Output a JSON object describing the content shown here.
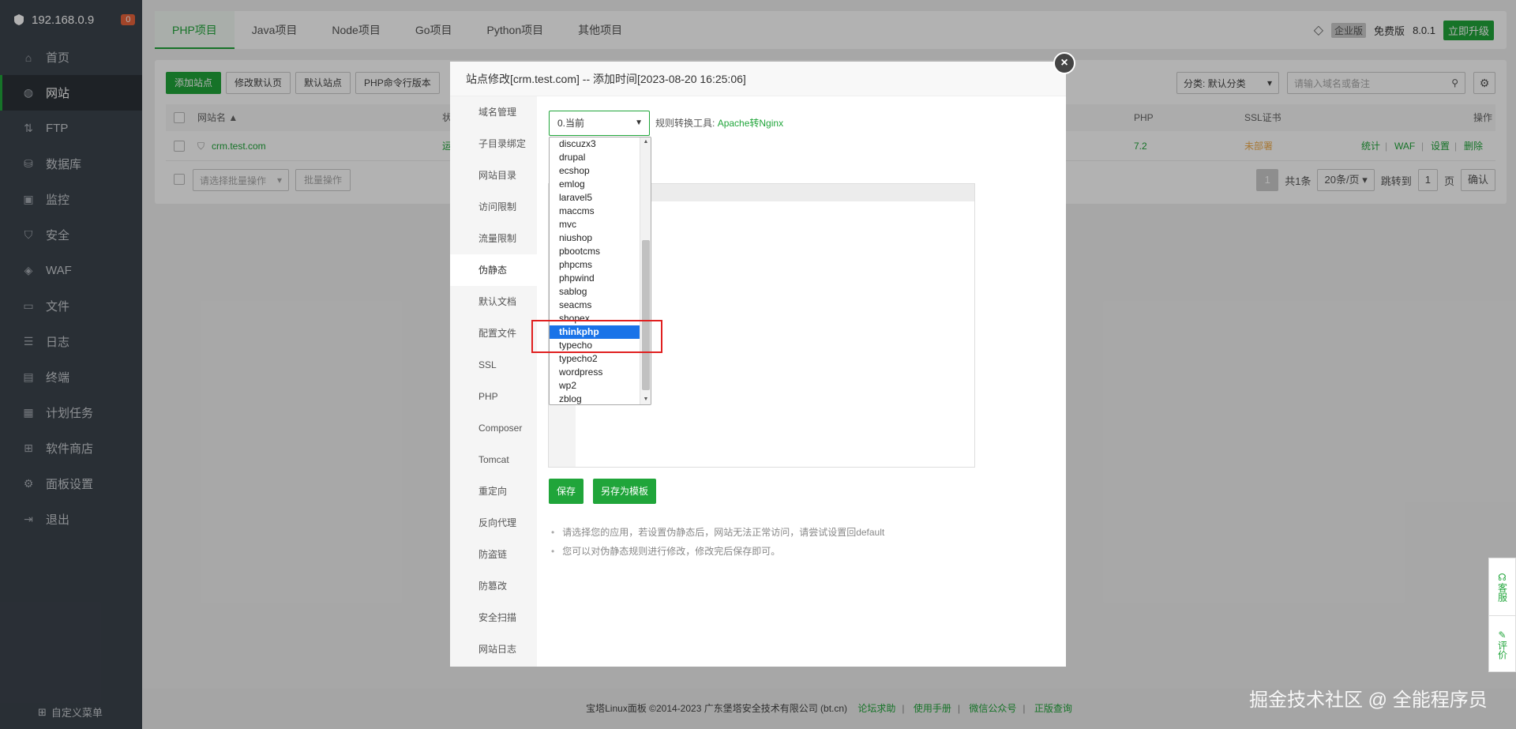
{
  "sidebar": {
    "server": "192.168.0.9",
    "badge": "0",
    "items": [
      {
        "label": "首页"
      },
      {
        "label": "网站"
      },
      {
        "label": "FTP"
      },
      {
        "label": "数据库"
      },
      {
        "label": "监控"
      },
      {
        "label": "安全"
      },
      {
        "label": "WAF"
      },
      {
        "label": "文件"
      },
      {
        "label": "日志"
      },
      {
        "label": "终端"
      },
      {
        "label": "计划任务"
      },
      {
        "label": "软件商店"
      },
      {
        "label": "面板设置"
      },
      {
        "label": "退出"
      }
    ],
    "footer": "自定义菜单"
  },
  "header": {
    "tabs": [
      {
        "label": "PHP项目"
      },
      {
        "label": "Java项目"
      },
      {
        "label": "Node项目"
      },
      {
        "label": "Go项目"
      },
      {
        "label": "Python项目"
      },
      {
        "label": "其他项目"
      }
    ],
    "edition": "企业版",
    "free": "免费版",
    "version": "8.0.1",
    "upgrade": "立即升级"
  },
  "site_panel": {
    "buttons": [
      "添加站点",
      "修改默认页",
      "默认站点",
      "PHP命令行版本"
    ],
    "category": "分类: 默认分类",
    "search_placeholder": "请输入域名或备注",
    "columns": {
      "name": "网站名 ▲",
      "status": "状态",
      "php": "PHP",
      "ssl": "SSL证书",
      "ops": "操作"
    },
    "row": {
      "name": "crm.test.com",
      "status": "运行",
      "php": "7.2",
      "ssl": "未部署",
      "ops": [
        "统计",
        "WAF",
        "设置",
        "删除"
      ]
    },
    "batch_placeholder": "请选择批量操作",
    "batch_btn": "批量操作",
    "pager": {
      "page": "1",
      "total": "共1条",
      "per_page": "20条/页",
      "jump": "跳转到",
      "jump_val": "1",
      "unit": "页",
      "confirm": "确认"
    }
  },
  "dialog": {
    "title": "站点修改[crm.test.com] -- 添加时间[2023-08-20 16:25:06]",
    "close": "×",
    "nav": [
      {
        "label": "域名管理"
      },
      {
        "label": "子目录绑定"
      },
      {
        "label": "网站目录"
      },
      {
        "label": "访问限制"
      },
      {
        "label": "流量限制"
      },
      {
        "label": "伪静态"
      },
      {
        "label": "默认文档"
      },
      {
        "label": "配置文件"
      },
      {
        "label": "SSL"
      },
      {
        "label": "PHP"
      },
      {
        "label": "Composer"
      },
      {
        "label": "Tomcat"
      },
      {
        "label": "重定向"
      },
      {
        "label": "反向代理"
      },
      {
        "label": "防盗链"
      },
      {
        "label": "防篡改"
      },
      {
        "label": "安全扫描"
      },
      {
        "label": "网站日志"
      }
    ],
    "rewrite_select": "0.当前",
    "convert_label": "规则转换工具:",
    "convert_link": "Apache转Nginx",
    "dropdown_options": [
      "discuzx3",
      "drupal",
      "ecshop",
      "emlog",
      "laravel5",
      "maccms",
      "mvc",
      "niushop",
      "pbootcms",
      "phpcms",
      "phpwind",
      "sablog",
      "seacms",
      "shopex",
      "thinkphp",
      "typecho",
      "typecho2",
      "wordpress",
      "wp2",
      "zblog"
    ],
    "dropdown_selected": "thinkphp",
    "save": "保存",
    "save_template": "另存为模板",
    "tips": [
      "请选择您的应用，若设置伪静态后，网站无法正常访问，请尝试设置回default",
      "您可以对伪静态规则进行修改，修改完后保存即可。"
    ]
  },
  "footer": {
    "copyright": "宝塔Linux面板 ©2014-2023 广东堡塔安全技术有限公司 (bt.cn)",
    "links": [
      "论坛求助",
      "使用手册",
      "微信公众号",
      "正版查询"
    ]
  },
  "float": {
    "service": "客服",
    "rate": "评价"
  },
  "watermark": "掘金技术社区 @ 全能程序员"
}
